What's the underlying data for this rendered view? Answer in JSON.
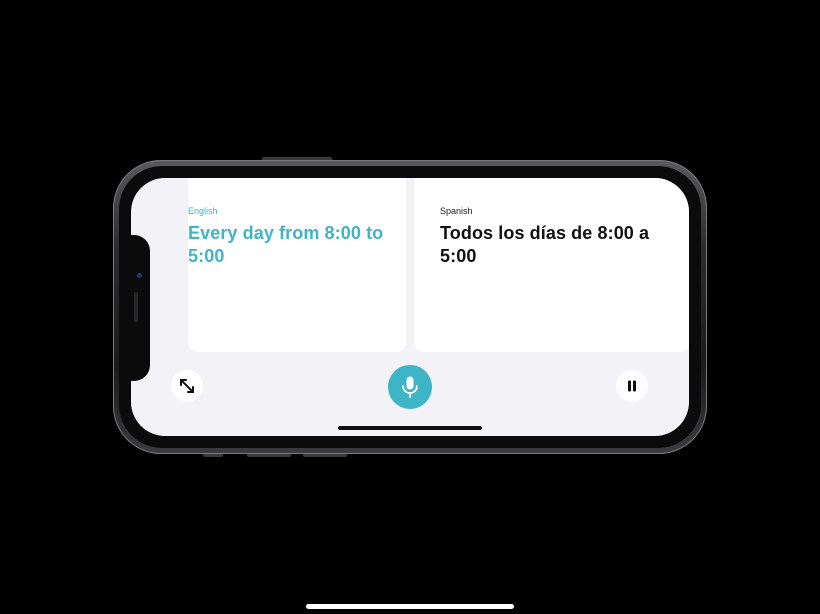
{
  "source_language": {
    "label": "English",
    "phrase": "Every day from 8:00 to 5:00"
  },
  "target_language": {
    "label": "Spanish",
    "phrase": "Todos los días de 8:00 a 5:00"
  },
  "controls": {
    "expand_icon": "expand-arrows-icon",
    "mic_icon": "microphone-icon",
    "pause_icon": "pause-icon"
  },
  "colors": {
    "accent": "#3eb5c7",
    "screen_background": "#f2f2f7",
    "card_background": "#ffffff",
    "outer_background": "#000000"
  }
}
